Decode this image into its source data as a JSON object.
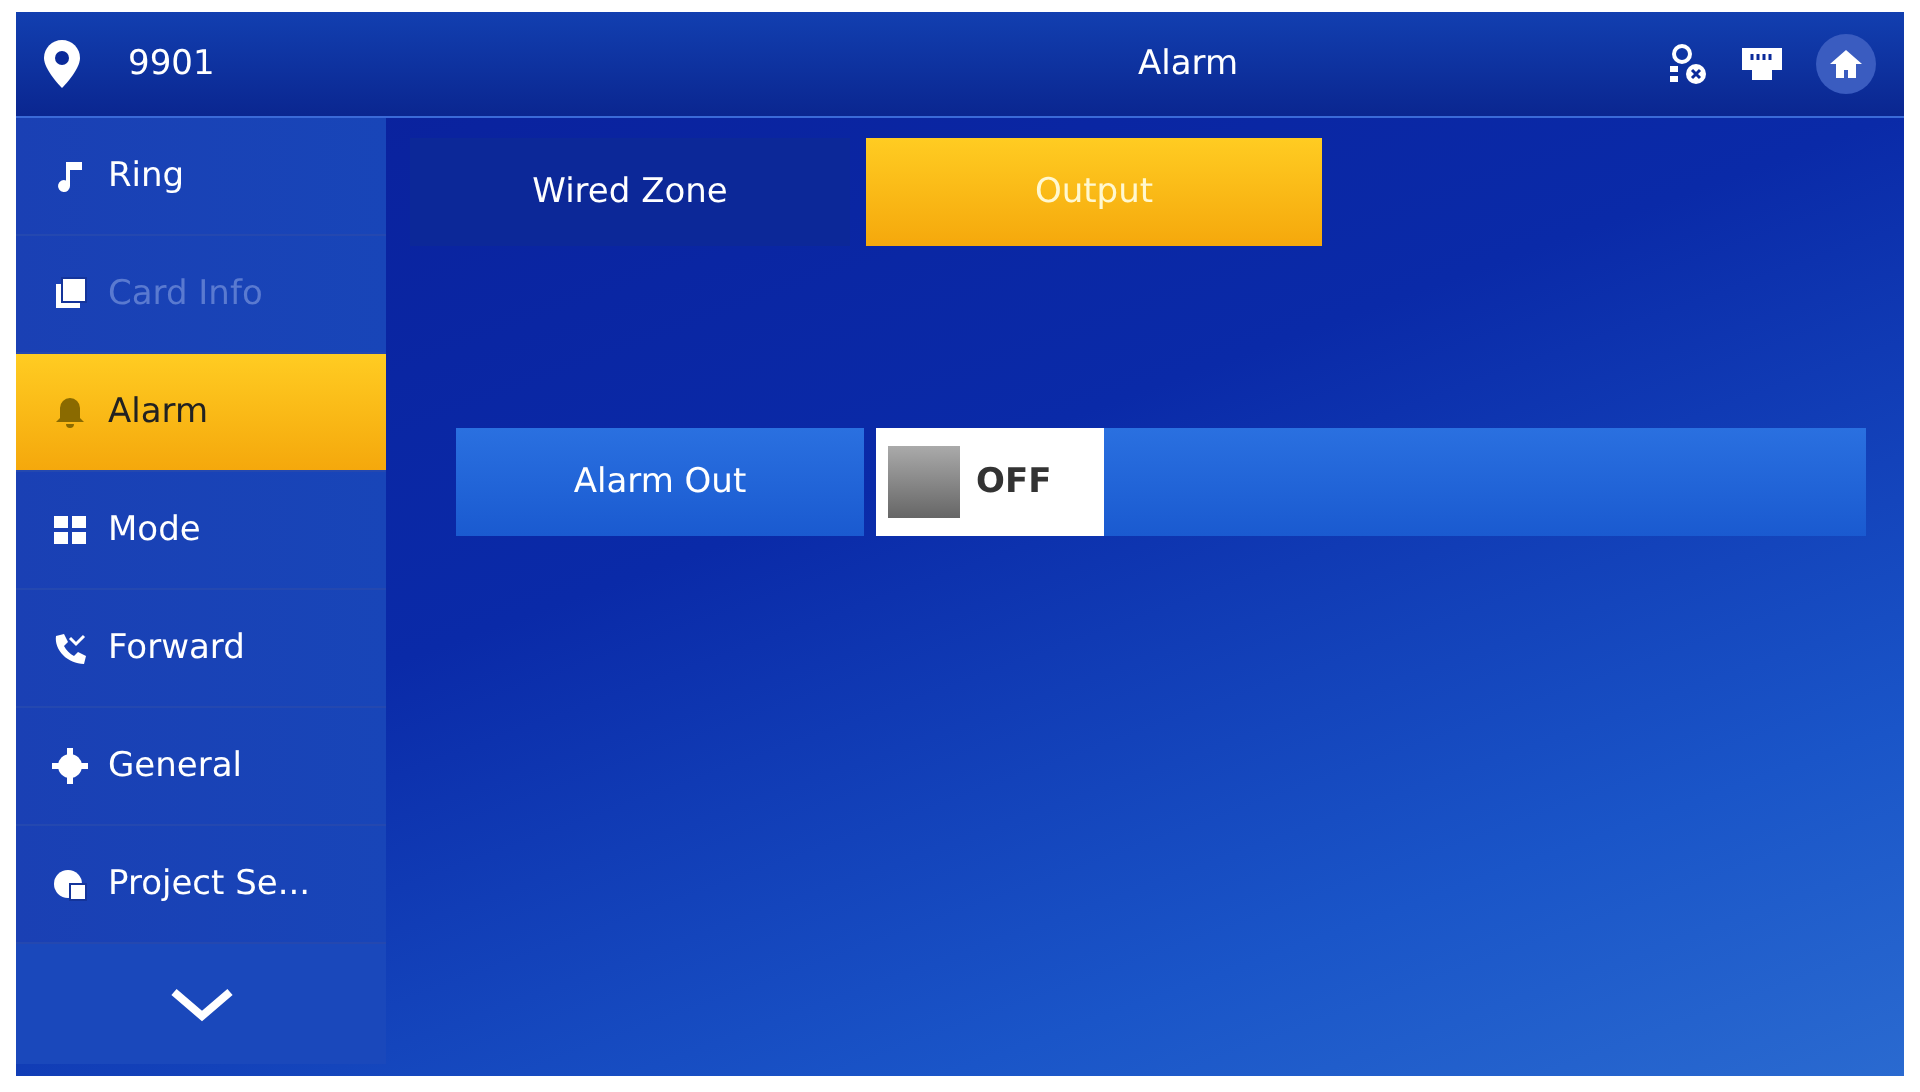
{
  "header": {
    "room": "9901",
    "title": "Alarm"
  },
  "sidebar": {
    "items": [
      {
        "label": "Ring",
        "selected": false,
        "disabled": false
      },
      {
        "label": "Card Info",
        "selected": false,
        "disabled": true
      },
      {
        "label": "Alarm",
        "selected": true,
        "disabled": false
      },
      {
        "label": "Mode",
        "selected": false,
        "disabled": false
      },
      {
        "label": "Forward",
        "selected": false,
        "disabled": false
      },
      {
        "label": "General",
        "selected": false,
        "disabled": false
      },
      {
        "label": "Project Se...",
        "selected": false,
        "disabled": false
      }
    ]
  },
  "tabs": [
    {
      "label": "Wired Zone",
      "selected": false
    },
    {
      "label": "Output",
      "selected": true
    }
  ],
  "settings": [
    {
      "label": "Alarm Out",
      "on": false,
      "state_text": "OFF"
    }
  ]
}
